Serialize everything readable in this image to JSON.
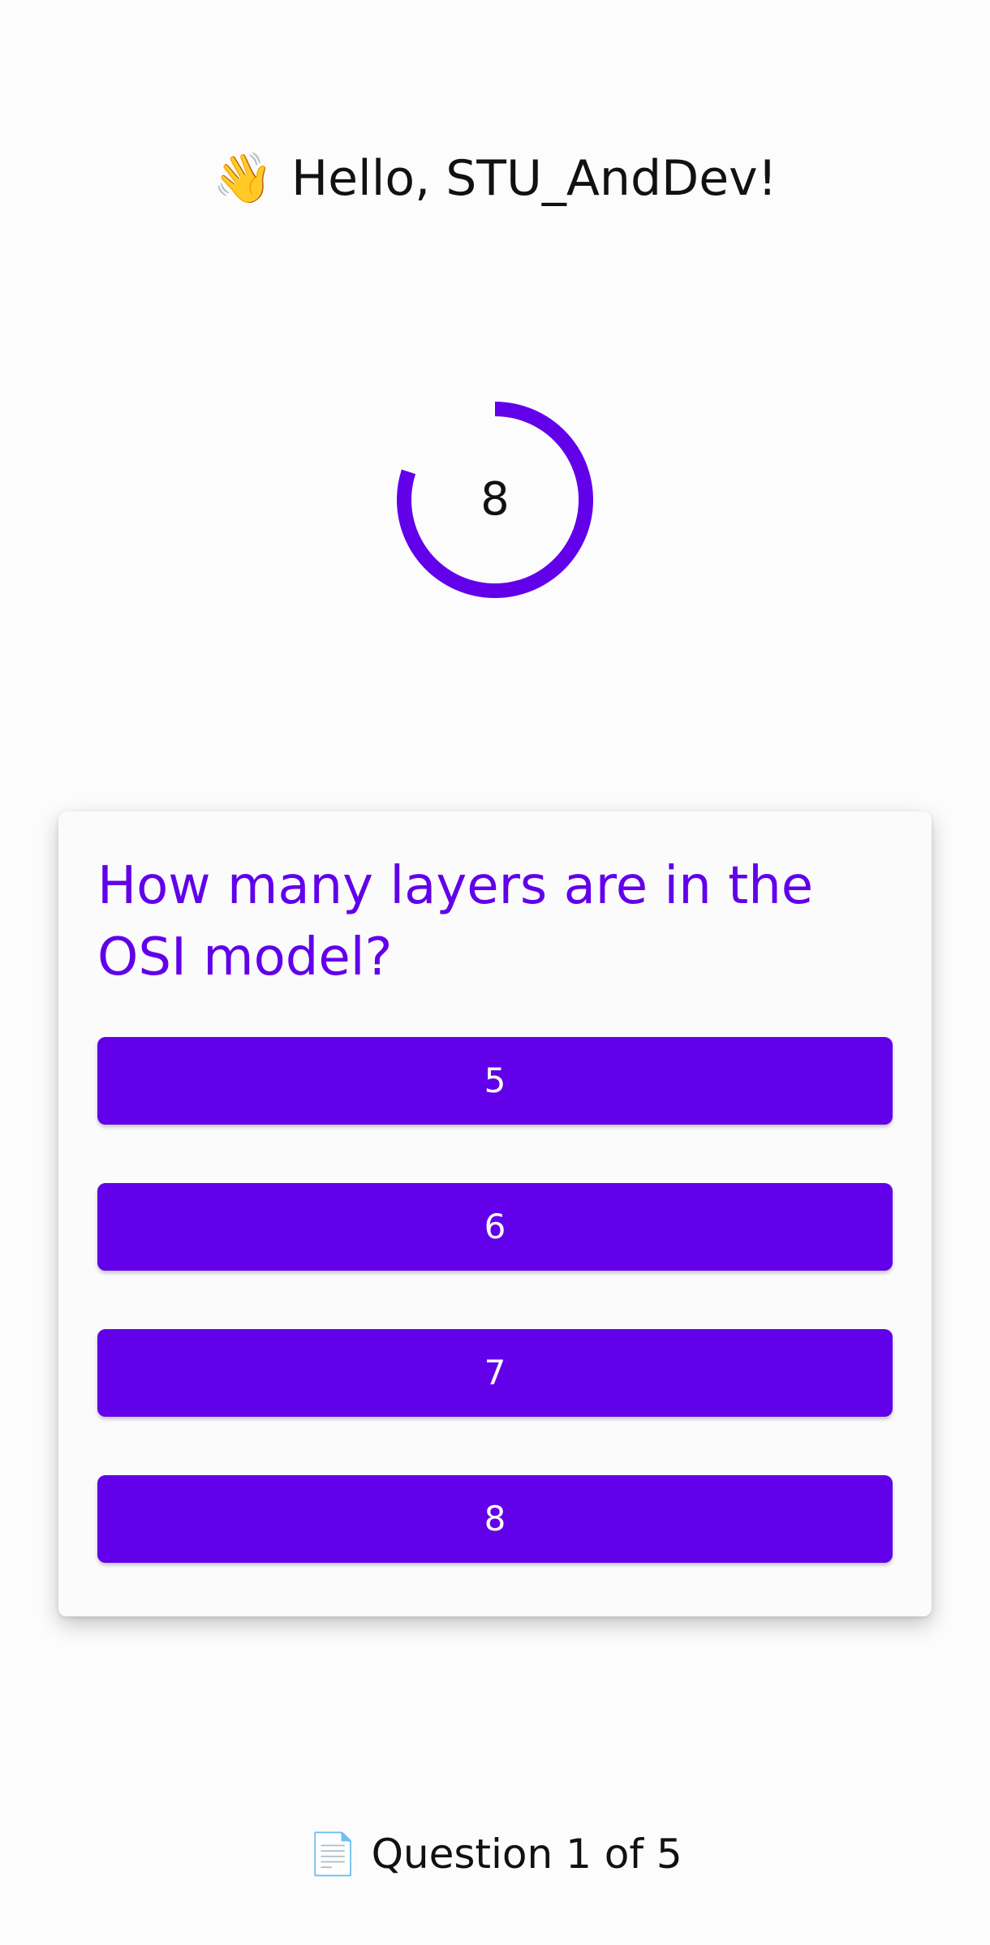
{
  "header": {
    "wave_emoji": "👋",
    "greeting": "Hello, STU_AndDev!"
  },
  "timer": {
    "value": "8",
    "color": "#6200ea",
    "remaining_fraction": 0.8
  },
  "quiz": {
    "question": "How many layers are in the OSI model?",
    "answers": [
      "5",
      "6",
      "7",
      "8"
    ],
    "accent_color": "#6200ea"
  },
  "footer": {
    "doc_emoji": "📄",
    "progress_text": "Question 1 of 5"
  }
}
